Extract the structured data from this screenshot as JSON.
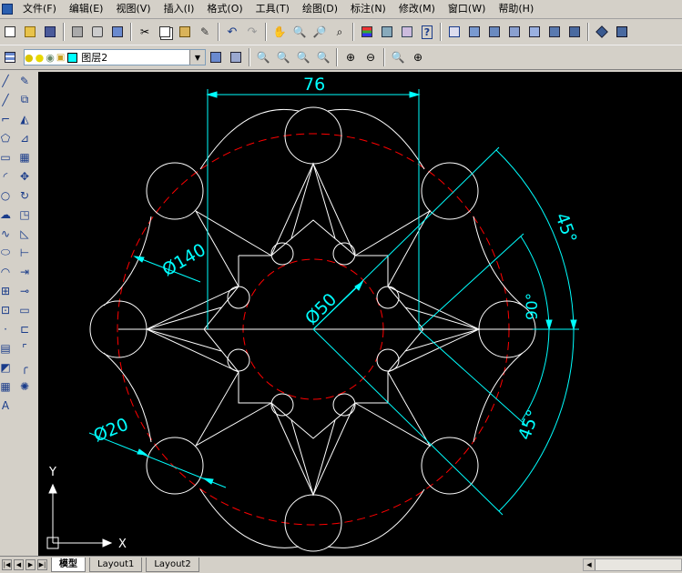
{
  "menu": [
    "文件(F)",
    "编辑(E)",
    "视图(V)",
    "插入(I)",
    "格式(O)",
    "工具(T)",
    "绘图(D)",
    "标注(N)",
    "修改(M)",
    "窗口(W)",
    "帮助(H)"
  ],
  "layer": {
    "name": "图层2"
  },
  "drawing": {
    "dims": {
      "width": "76",
      "outer_diameter": "Ø140",
      "inner_diameter": "Ø50",
      "small_diameter": "Ø20",
      "angle_top": "45°",
      "angle_mid": "90°",
      "angle_bottom": "45°"
    },
    "ucs": {
      "x": "X",
      "y": "Y"
    }
  },
  "tabs": [
    "模型",
    "Layout1",
    "Layout2"
  ],
  "colors": {
    "background": "#000000",
    "geometry": "#ffffff",
    "centerline": "#ff0000",
    "dimension": "#00ffff"
  }
}
